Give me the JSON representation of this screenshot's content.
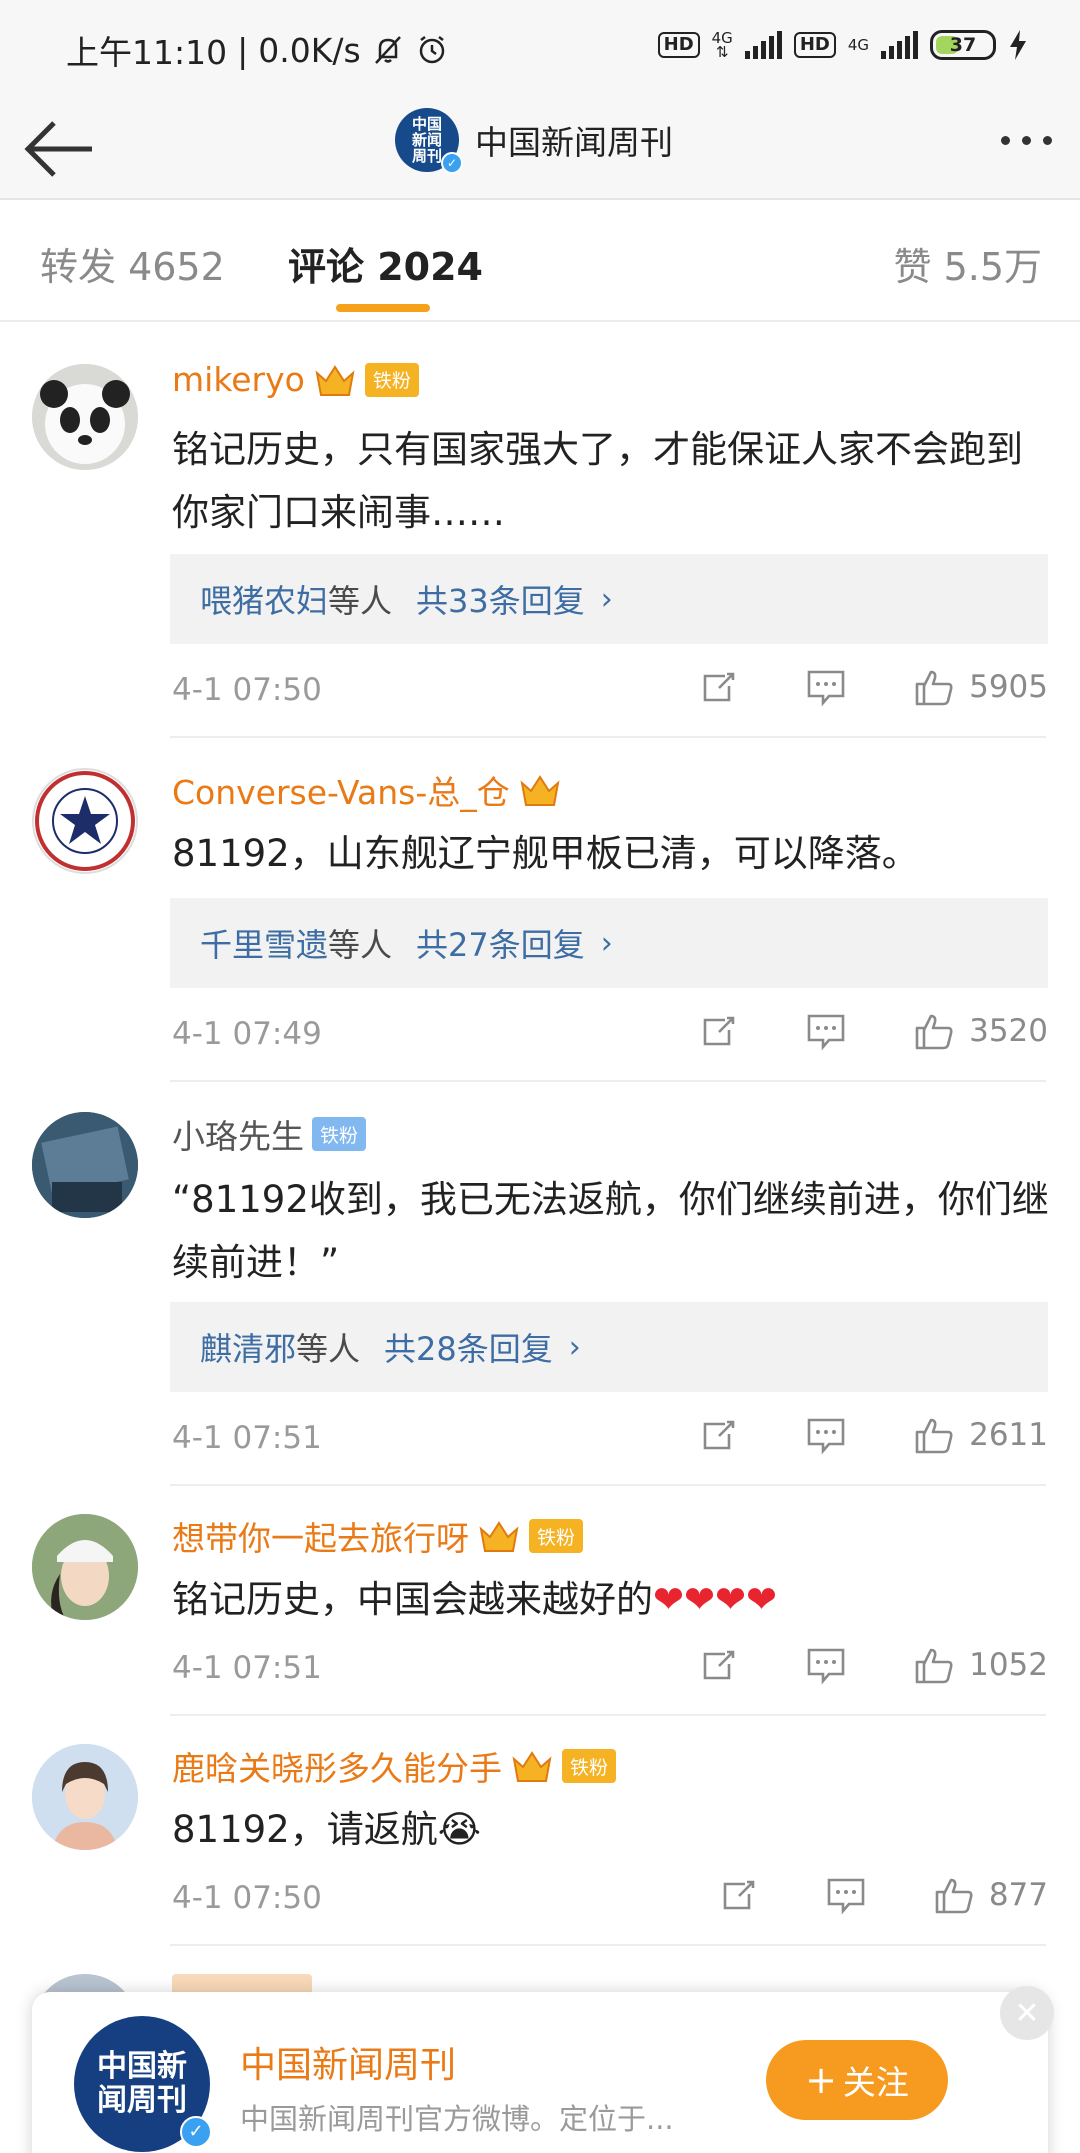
{
  "status_bar": {
    "time": "上午11:10",
    "net_speed": "0.0K/s",
    "hd1": "HD",
    "net1": "4G",
    "hd2": "HD",
    "net2": "4G",
    "battery": "37",
    "battery_level": 0.37
  },
  "nav": {
    "title": "中国新闻周刊",
    "avatar_text": "中国新闻周刊"
  },
  "tabs": {
    "repost": "转发 4652",
    "comments": "评论 2024",
    "likes": "赞 5.5万"
  },
  "comments": [
    {
      "name": "mikeryo",
      "fan_badge": "铁粉",
      "text": "铭记历史，只有国家强大了，才能保证人家不会跑到你家门口来闹事……",
      "reply_name": "喂猪农妇",
      "reply_suffix": "等人",
      "reply_count": "共33条回复",
      "time": "4-1 07:50",
      "likes": "5905"
    },
    {
      "name": "Converse-Vans-总_仓",
      "text": "81192，山东舰辽宁舰甲板已清，可以降落。",
      "reply_name": "千里雪遗",
      "reply_suffix": "等人",
      "reply_count": "共27条回复",
      "time": "4-1 07:49",
      "likes": "3520"
    },
    {
      "name": "小珞先生",
      "fan_badge": "铁粉",
      "text": "“81192收到，我已无法返航，你们继续前进，你们继续前进！”",
      "reply_name": "麒清邪",
      "reply_suffix": "等人",
      "reply_count": "共28条回复",
      "time": "4-1 07:51",
      "likes": "2611"
    },
    {
      "name": "想带你一起去旅行呀",
      "fan_badge": "铁粉",
      "text": "铭记历史，中国会越来越好的",
      "emoji": "❤❤❤❤",
      "time": "4-1 07:51",
      "likes": "1052"
    },
    {
      "name": "鹿晗关晓彤多久能分手",
      "fan_badge": "铁粉",
      "text": "81192，请返航",
      "emoji": "😭",
      "time": "4-1 07:50",
      "likes": "877"
    }
  ],
  "follow_card": {
    "name": "中国新闻周刊",
    "desc": "中国新闻周刊官方微博。定位于...",
    "button": "关注",
    "avatar_text": "中国新闻周刊"
  },
  "icons": {
    "share": "share-icon",
    "comment": "comment-icon",
    "like": "like-icon"
  },
  "colors": {
    "accent": "#f7a11a",
    "username_orange": "#ea7a16",
    "link_blue": "#3d6da3"
  }
}
